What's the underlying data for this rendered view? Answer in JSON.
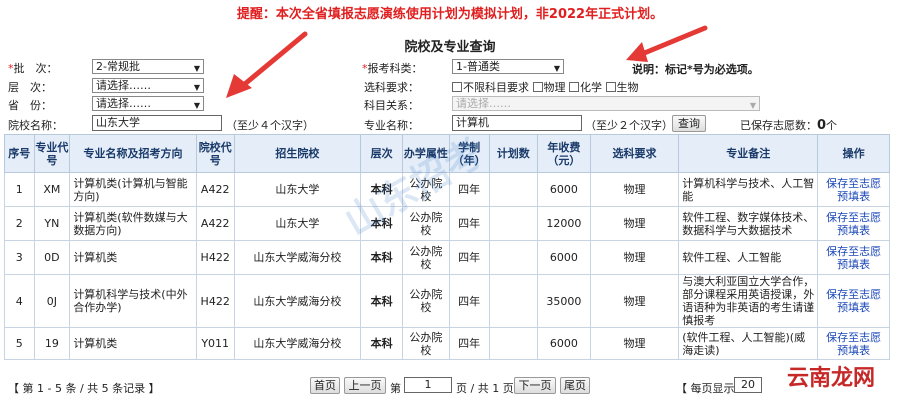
{
  "notice": "提醒：本次全省填报志愿演练使用计划为模拟计划，非2022年正式计划。",
  "page_title": "院校及专业查询",
  "form": {
    "batch": {
      "label": "批　次：",
      "value": "2-常规批"
    },
    "level": {
      "label": "层　次：",
      "value": "请选择……"
    },
    "province": {
      "label": "省　份：",
      "value": "请选择……"
    },
    "school_name": {
      "label": "院校名称：",
      "value": "山东大学",
      "hint": "（至少４个汉字）"
    },
    "subject_type": {
      "label": "报考科类：",
      "value": "1-普通类"
    },
    "note": "说明：标记*号为必选项。",
    "subject_req": {
      "label": "选科要求：",
      "options": [
        "不限科目要求",
        "物理",
        "化学",
        "生物"
      ]
    },
    "subject_rel": {
      "label": "科目关系：",
      "value": "请选择……"
    },
    "major_name": {
      "label": "专业名称：",
      "value": "计算机",
      "hint": "（至少２个汉字）"
    },
    "query_button": "查询",
    "saved_count_label": "已保存志愿数：",
    "saved_count": "0",
    "saved_count_unit": "个"
  },
  "table": {
    "headers": [
      "序号",
      "专业代号",
      "专业名称及招考方向",
      "院校代号",
      "招生院校",
      "层次",
      "办学属性",
      "学制（年）",
      "计划数",
      "年收费（元）",
      "选科要求",
      "专业备注",
      "操作"
    ],
    "rows": [
      {
        "no": "1",
        "code": "XM",
        "major": "计算机类(计算机与智能方向)",
        "school_code": "A422",
        "school": "山东大学",
        "level": "本科",
        "attr": "公办院校",
        "years": "四年",
        "plan": "",
        "fee": "6000",
        "req": "物理",
        "remark": "计算机科学与技术、人工智能",
        "op": "保存至志愿预填表"
      },
      {
        "no": "2",
        "code": "YN",
        "major": "计算机类(软件数媒与大数据方向)",
        "school_code": "A422",
        "school": "山东大学",
        "level": "本科",
        "attr": "公办院校",
        "years": "四年",
        "plan": "",
        "fee": "12000",
        "req": "物理",
        "remark": "软件工程、数字媒体技术、数据科学与大数据技术",
        "op": "保存至志愿预填表"
      },
      {
        "no": "3",
        "code": "0D",
        "major": "计算机类",
        "school_code": "H422",
        "school": "山东大学威海分校",
        "level": "本科",
        "attr": "公办院校",
        "years": "四年",
        "plan": "",
        "fee": "6000",
        "req": "物理",
        "remark": "软件工程、人工智能",
        "op": "保存至志愿预填表"
      },
      {
        "no": "4",
        "code": "0J",
        "major": "计算机科学与技术(中外合作办学)",
        "school_code": "H422",
        "school": "山东大学威海分校",
        "level": "本科",
        "attr": "公办院校",
        "years": "四年",
        "plan": "",
        "fee": "35000",
        "req": "物理",
        "remark": "与澳大利亚国立大学合作，部分课程采用英语授课，外语语种为非英语的考生请谨慎报考",
        "op": "保存至志愿预填表"
      },
      {
        "no": "5",
        "code": "19",
        "major": "计算机类",
        "school_code": "Y011",
        "school": "山东大学威海分校",
        "level": "本科",
        "attr": "公办院校",
        "years": "四年",
        "plan": "",
        "fee": "6000",
        "req": "物理",
        "remark": "(软件工程、人工智能)(威海走读)",
        "op": "保存至志愿预填表"
      }
    ]
  },
  "pager": {
    "summary": "【 第 1 - 5 条 / 共 5 条记录 】",
    "first": "首页",
    "prev": "上一页",
    "page_prefix": "第",
    "page_value": "1",
    "page_suffix": "页 / 共 1 页",
    "next": "下一页",
    "last": "尾页",
    "per_page_prefix": "【 每页显示",
    "per_page_value": "20"
  },
  "watermark": "山东招考",
  "corner_watermark": "云南龙网",
  "colors": {
    "accent_red": "#e02020",
    "header_bg": "#e5eef8",
    "link": "#1a47b8"
  }
}
